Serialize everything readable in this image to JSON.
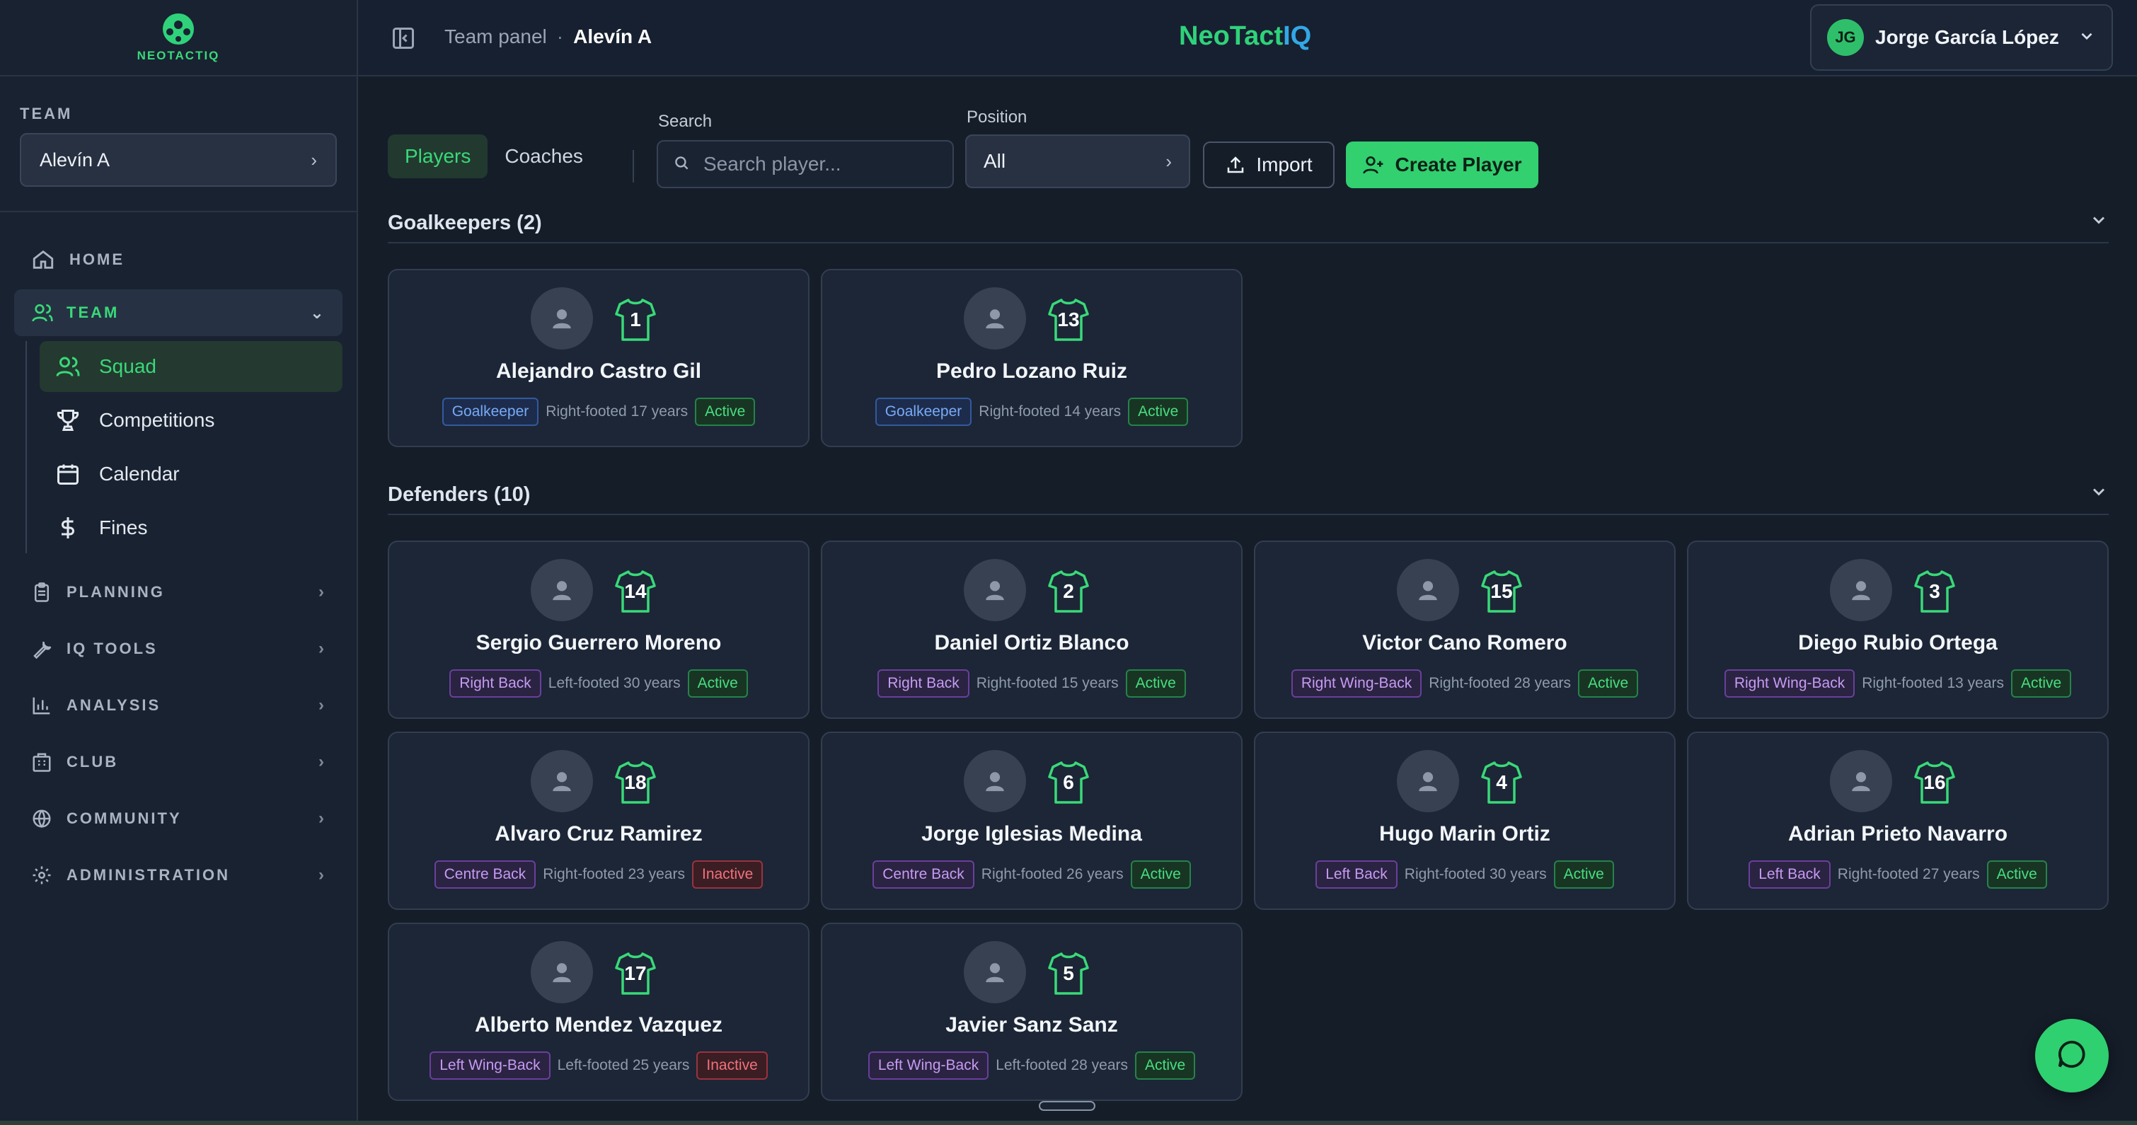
{
  "app": {
    "brand_part1": "NeoTact",
    "brand_part2": "IQ",
    "logo_text": "NEOTACTIQ"
  },
  "header": {
    "crumb_parent": "Team panel",
    "crumb_sep": "·",
    "crumb_current": "Alevín A",
    "user_initials": "JG",
    "user_name": "Jorge García López"
  },
  "sidebar": {
    "team_label": "TEAM",
    "team_value": "Alevín A",
    "home": "HOME",
    "team_section": "TEAM",
    "team_sub": [
      "Squad",
      "Competitions",
      "Calendar",
      "Fines"
    ],
    "sections": [
      "PLANNING",
      "IQ TOOLS",
      "ANALYSIS",
      "CLUB",
      "COMMUNITY",
      "ADMINISTRATION"
    ]
  },
  "toolbar": {
    "tabs": [
      "Players",
      "Coaches"
    ],
    "search_label": "Search",
    "search_placeholder": "Search player...",
    "position_label": "Position",
    "position_value": "All",
    "import_label": "Import",
    "create_label": "Create Player"
  },
  "groups": [
    {
      "title": "Goalkeepers (2)",
      "players": [
        {
          "number": "1",
          "name": "Alejandro Castro Gil",
          "position": "Goalkeeper",
          "foot": "Right-footed",
          "age": "17 years",
          "status": "Active"
        },
        {
          "number": "13",
          "name": "Pedro Lozano Ruiz",
          "position": "Goalkeeper",
          "foot": "Right-footed",
          "age": "14 years",
          "status": "Active"
        }
      ]
    },
    {
      "title": "Defenders (10)",
      "players": [
        {
          "number": "14",
          "name": "Sergio Guerrero Moreno",
          "position": "Right Back",
          "foot": "Left-footed",
          "age": "30 years",
          "status": "Active"
        },
        {
          "number": "2",
          "name": "Daniel Ortiz Blanco",
          "position": "Right Back",
          "foot": "Right-footed",
          "age": "15 years",
          "status": "Active"
        },
        {
          "number": "15",
          "name": "Victor Cano Romero",
          "position": "Right Wing-Back",
          "foot": "Right-footed",
          "age": "28 years",
          "status": "Active"
        },
        {
          "number": "3",
          "name": "Diego Rubio Ortega",
          "position": "Right Wing-Back",
          "foot": "Right-footed",
          "age": "13 years",
          "status": "Active"
        },
        {
          "number": "18",
          "name": "Alvaro Cruz Ramirez",
          "position": "Centre Back",
          "foot": "Right-footed",
          "age": "23 years",
          "status": "Inactive"
        },
        {
          "number": "6",
          "name": "Jorge Iglesias Medina",
          "position": "Centre Back",
          "foot": "Right-footed",
          "age": "26 years",
          "status": "Active"
        },
        {
          "number": "4",
          "name": "Hugo Marin Ortiz",
          "position": "Left Back",
          "foot": "Right-footed",
          "age": "30 years",
          "status": "Active"
        },
        {
          "number": "16",
          "name": "Adrian Prieto Navarro",
          "position": "Left Back",
          "foot": "Right-footed",
          "age": "27 years",
          "status": "Active"
        },
        {
          "number": "17",
          "name": "Alberto Mendez Vazquez",
          "position": "Left Wing-Back",
          "foot": "Left-footed",
          "age": "25 years",
          "status": "Inactive"
        },
        {
          "number": "5",
          "name": "Javier Sanz Sanz",
          "position": "Left Wing-Back",
          "foot": "Left-footed",
          "age": "28 years",
          "status": "Active"
        }
      ]
    }
  ],
  "colors": {
    "accent": "#32d06f",
    "background": "#151d29",
    "sidebar": "#192231"
  }
}
